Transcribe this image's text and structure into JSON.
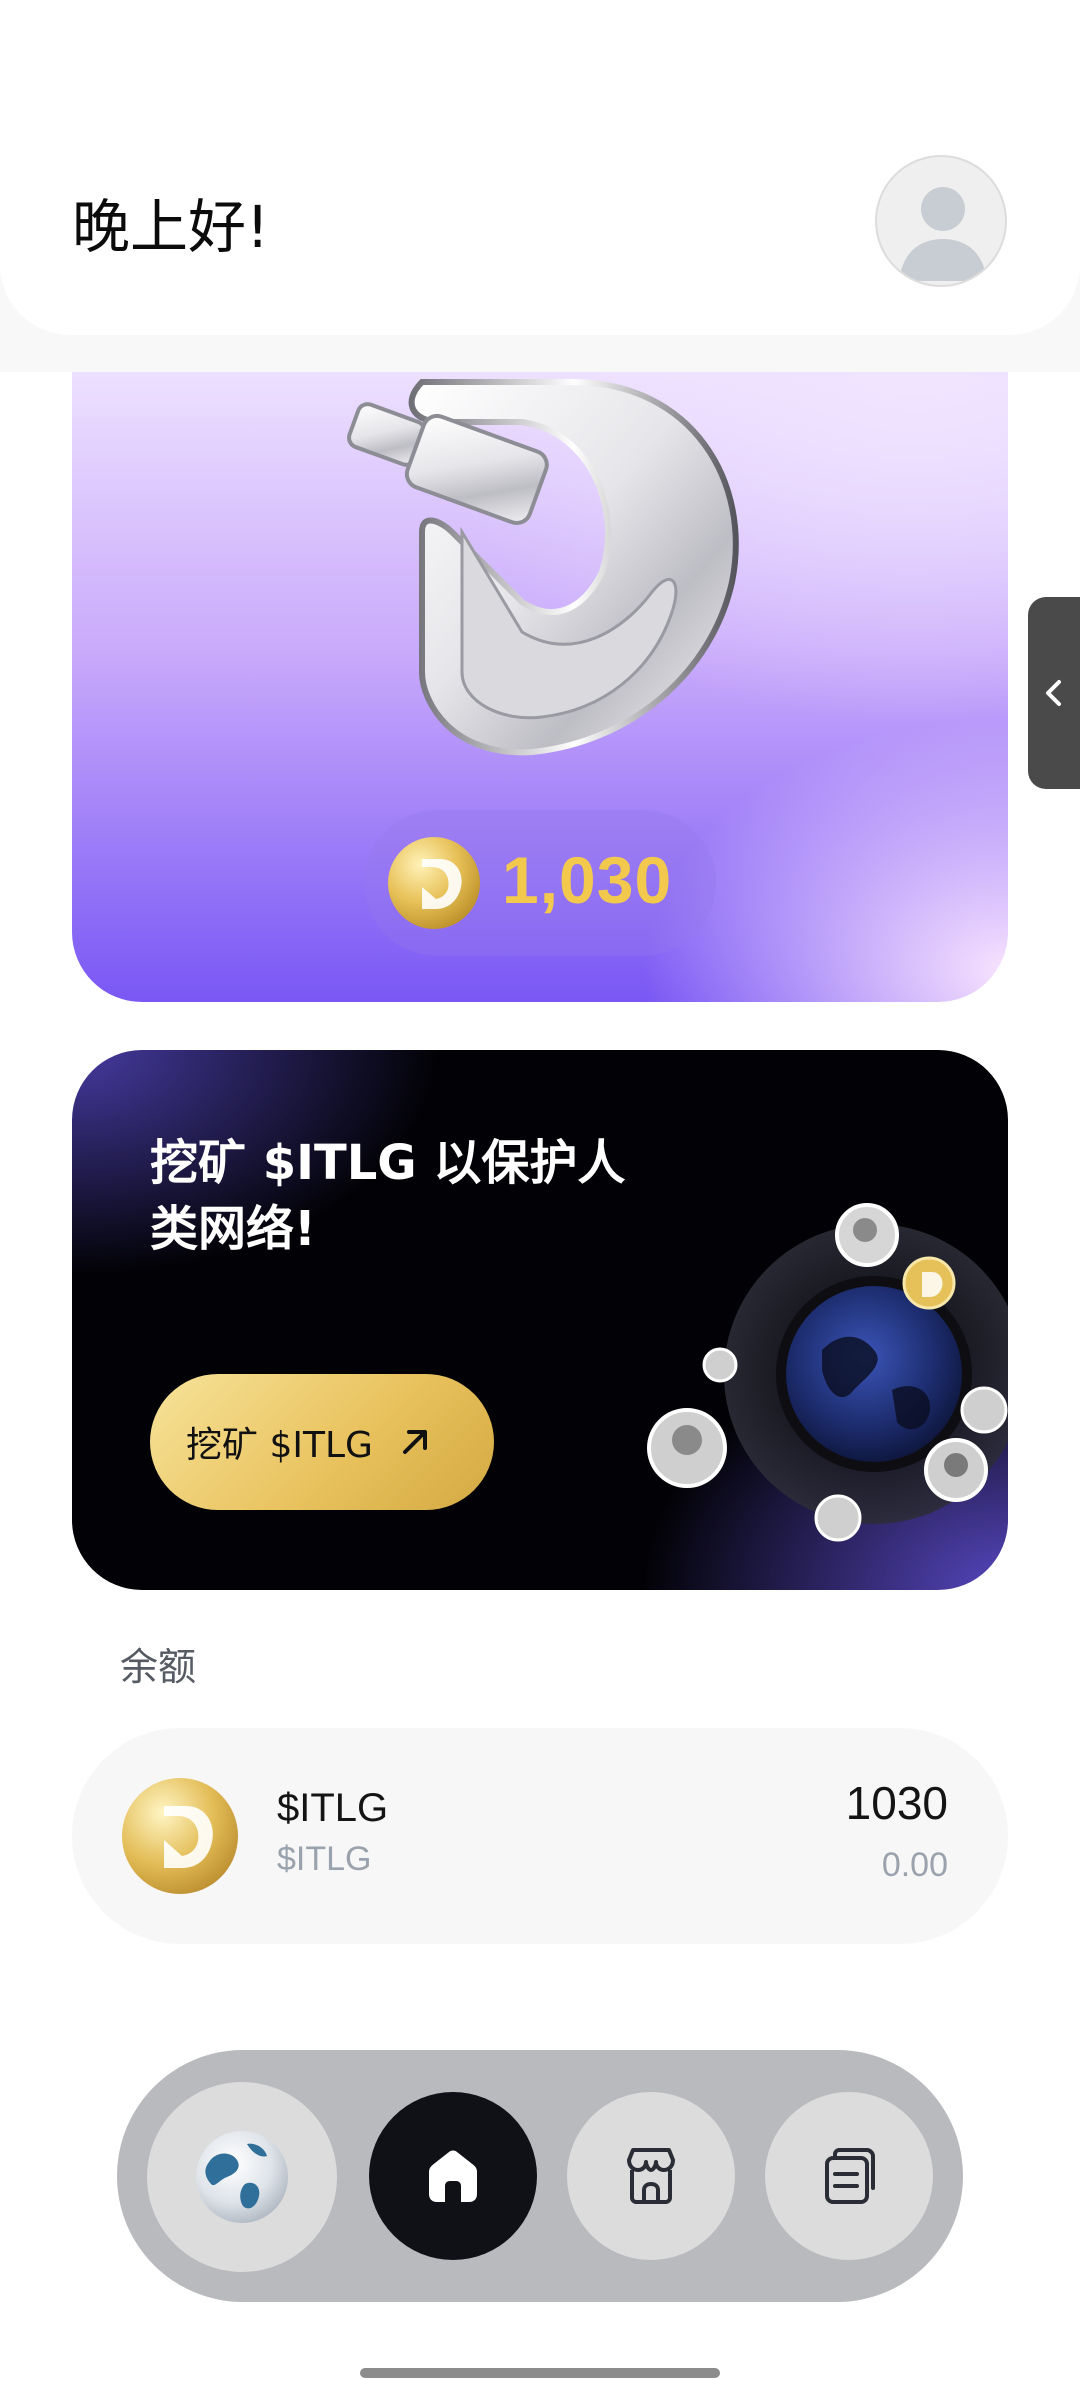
{
  "header": {
    "greeting": "晚上好!"
  },
  "hero": {
    "coin_amount": "1,030"
  },
  "promo": {
    "title": "挖矿 $ITLG 以保护人类网络!",
    "button_label": "挖矿 $ITLG"
  },
  "balance": {
    "section_label": "余额",
    "token_name": "$ITLG",
    "token_symbol": "$ITLG",
    "amount": "1030",
    "value": "0.00"
  },
  "nav": {
    "items": [
      {
        "icon": "globe-icon"
      },
      {
        "icon": "home-icon",
        "active": true
      },
      {
        "icon": "shop-icon"
      },
      {
        "icon": "document-icon"
      }
    ]
  },
  "colors": {
    "gold": "#f2c94c",
    "purple": "#7a57f4",
    "dark": "#0f1117"
  }
}
